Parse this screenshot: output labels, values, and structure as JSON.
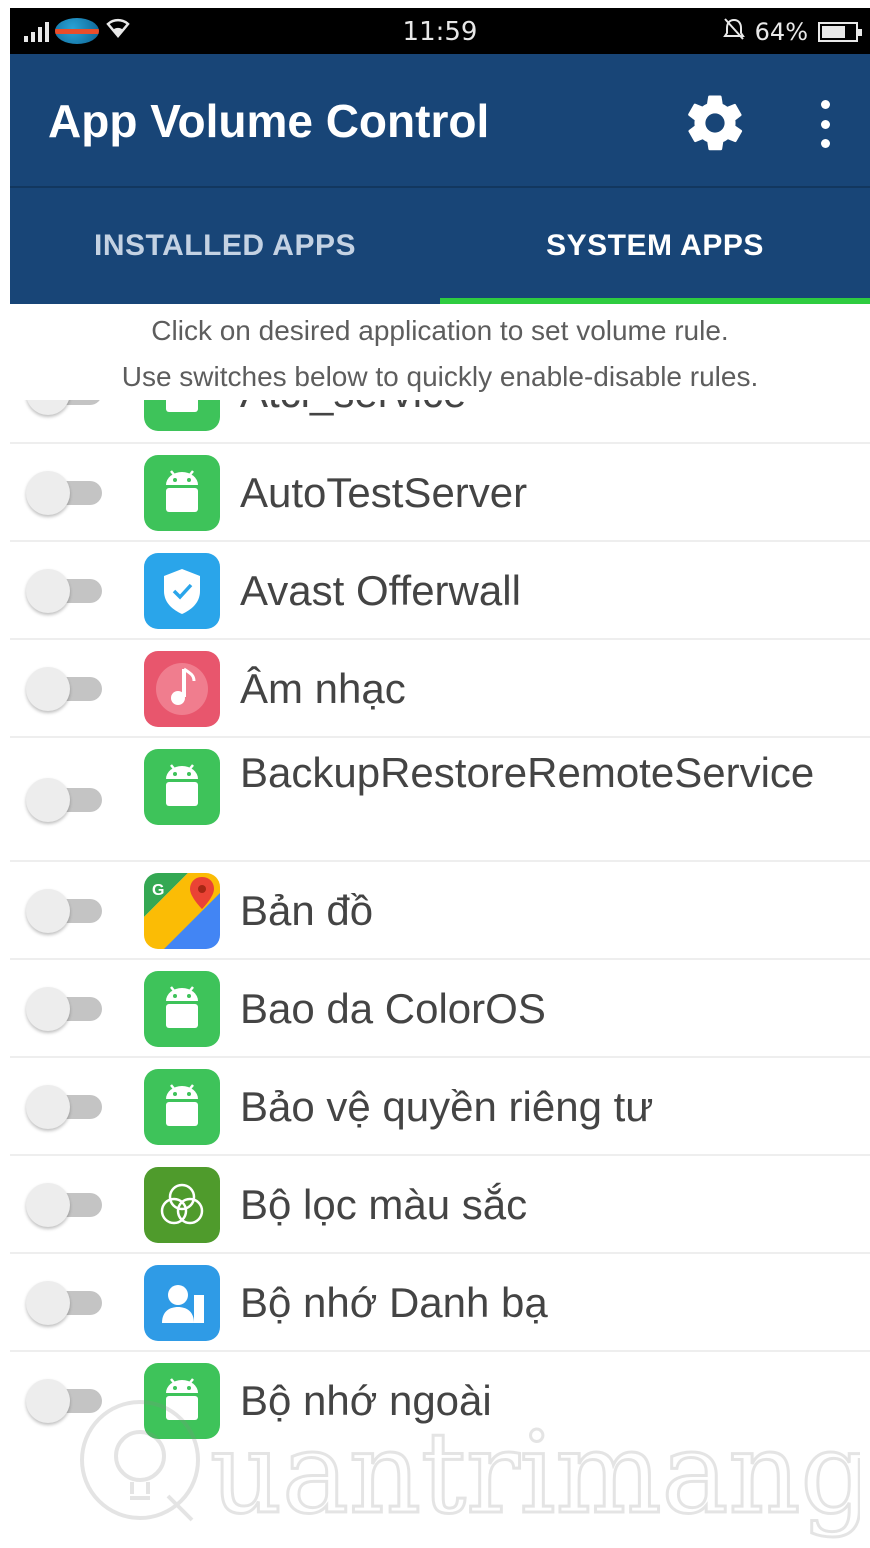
{
  "status_bar": {
    "time": "11:59",
    "battery_percent": "64%",
    "battery_level": 0.64
  },
  "app_bar": {
    "title": "App Volume Control"
  },
  "tabs": [
    {
      "label": "INSTALLED APPS",
      "selected": false
    },
    {
      "label": "SYSTEM APPS",
      "selected": true
    }
  ],
  "hint": {
    "line1": "Click on desired application to set volume rule.",
    "line2": "Use switches below to quickly enable-disable rules."
  },
  "apps": [
    {
      "name": "Atci_service",
      "icon": "android-icon",
      "enabled": false
    },
    {
      "name": "AutoTestServer",
      "icon": "android-icon",
      "enabled": false
    },
    {
      "name": "Avast Offerwall",
      "icon": "shield-icon",
      "enabled": false
    },
    {
      "name": "Âm nhạc",
      "icon": "music-note-icon",
      "enabled": false
    },
    {
      "name": "BackupRestoreRemoteService",
      "icon": "android-icon",
      "enabled": false
    },
    {
      "name": "Bản đồ",
      "icon": "maps-icon",
      "enabled": false
    },
    {
      "name": "Bao da ColorOS",
      "icon": "android-icon",
      "enabled": false
    },
    {
      "name": "Bảo vệ quyền riêng tư",
      "icon": "android-icon",
      "enabled": false
    },
    {
      "name": "Bộ lọc màu sắc",
      "icon": "color-filter-icon",
      "enabled": false
    },
    {
      "name": "Bộ nhớ Danh bạ",
      "icon": "contacts-icon",
      "enabled": false
    },
    {
      "name": "Bộ nhớ ngoài",
      "icon": "android-icon",
      "enabled": false
    }
  ],
  "colors": {
    "app_bar": "#184577",
    "tab_indicator": "#2ecc40",
    "android_icon": "#3ec35a",
    "shield_icon": "#2aa5ea",
    "music_icon": "#e8566d",
    "filter_icon": "#4f9b2c",
    "contacts_icon": "#2f9be6"
  },
  "watermark": {
    "text": "Quantrimang"
  }
}
